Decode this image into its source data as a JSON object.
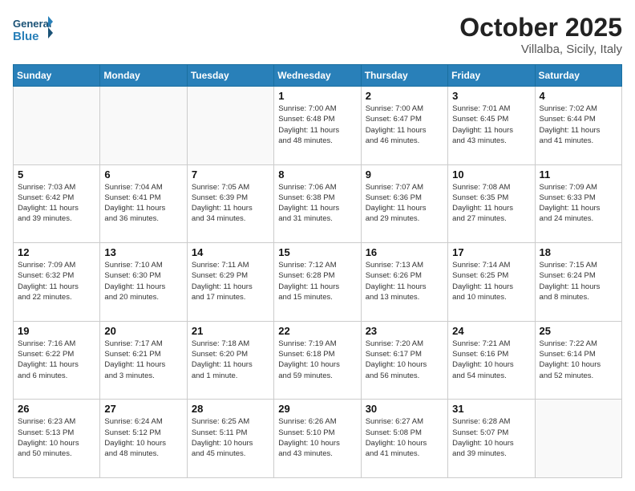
{
  "header": {
    "logo_general": "General",
    "logo_blue": "Blue",
    "month_title": "October 2025",
    "location": "Villalba, Sicily, Italy"
  },
  "days_of_week": [
    "Sunday",
    "Monday",
    "Tuesday",
    "Wednesday",
    "Thursday",
    "Friday",
    "Saturday"
  ],
  "weeks": [
    [
      {
        "day": "",
        "info": ""
      },
      {
        "day": "",
        "info": ""
      },
      {
        "day": "",
        "info": ""
      },
      {
        "day": "1",
        "info": "Sunrise: 7:00 AM\nSunset: 6:48 PM\nDaylight: 11 hours\nand 48 minutes."
      },
      {
        "day": "2",
        "info": "Sunrise: 7:00 AM\nSunset: 6:47 PM\nDaylight: 11 hours\nand 46 minutes."
      },
      {
        "day": "3",
        "info": "Sunrise: 7:01 AM\nSunset: 6:45 PM\nDaylight: 11 hours\nand 43 minutes."
      },
      {
        "day": "4",
        "info": "Sunrise: 7:02 AM\nSunset: 6:44 PM\nDaylight: 11 hours\nand 41 minutes."
      }
    ],
    [
      {
        "day": "5",
        "info": "Sunrise: 7:03 AM\nSunset: 6:42 PM\nDaylight: 11 hours\nand 39 minutes."
      },
      {
        "day": "6",
        "info": "Sunrise: 7:04 AM\nSunset: 6:41 PM\nDaylight: 11 hours\nand 36 minutes."
      },
      {
        "day": "7",
        "info": "Sunrise: 7:05 AM\nSunset: 6:39 PM\nDaylight: 11 hours\nand 34 minutes."
      },
      {
        "day": "8",
        "info": "Sunrise: 7:06 AM\nSunset: 6:38 PM\nDaylight: 11 hours\nand 31 minutes."
      },
      {
        "day": "9",
        "info": "Sunrise: 7:07 AM\nSunset: 6:36 PM\nDaylight: 11 hours\nand 29 minutes."
      },
      {
        "day": "10",
        "info": "Sunrise: 7:08 AM\nSunset: 6:35 PM\nDaylight: 11 hours\nand 27 minutes."
      },
      {
        "day": "11",
        "info": "Sunrise: 7:09 AM\nSunset: 6:33 PM\nDaylight: 11 hours\nand 24 minutes."
      }
    ],
    [
      {
        "day": "12",
        "info": "Sunrise: 7:09 AM\nSunset: 6:32 PM\nDaylight: 11 hours\nand 22 minutes."
      },
      {
        "day": "13",
        "info": "Sunrise: 7:10 AM\nSunset: 6:30 PM\nDaylight: 11 hours\nand 20 minutes."
      },
      {
        "day": "14",
        "info": "Sunrise: 7:11 AM\nSunset: 6:29 PM\nDaylight: 11 hours\nand 17 minutes."
      },
      {
        "day": "15",
        "info": "Sunrise: 7:12 AM\nSunset: 6:28 PM\nDaylight: 11 hours\nand 15 minutes."
      },
      {
        "day": "16",
        "info": "Sunrise: 7:13 AM\nSunset: 6:26 PM\nDaylight: 11 hours\nand 13 minutes."
      },
      {
        "day": "17",
        "info": "Sunrise: 7:14 AM\nSunset: 6:25 PM\nDaylight: 11 hours\nand 10 minutes."
      },
      {
        "day": "18",
        "info": "Sunrise: 7:15 AM\nSunset: 6:24 PM\nDaylight: 11 hours\nand 8 minutes."
      }
    ],
    [
      {
        "day": "19",
        "info": "Sunrise: 7:16 AM\nSunset: 6:22 PM\nDaylight: 11 hours\nand 6 minutes."
      },
      {
        "day": "20",
        "info": "Sunrise: 7:17 AM\nSunset: 6:21 PM\nDaylight: 11 hours\nand 3 minutes."
      },
      {
        "day": "21",
        "info": "Sunrise: 7:18 AM\nSunset: 6:20 PM\nDaylight: 11 hours\nand 1 minute."
      },
      {
        "day": "22",
        "info": "Sunrise: 7:19 AM\nSunset: 6:18 PM\nDaylight: 10 hours\nand 59 minutes."
      },
      {
        "day": "23",
        "info": "Sunrise: 7:20 AM\nSunset: 6:17 PM\nDaylight: 10 hours\nand 56 minutes."
      },
      {
        "day": "24",
        "info": "Sunrise: 7:21 AM\nSunset: 6:16 PM\nDaylight: 10 hours\nand 54 minutes."
      },
      {
        "day": "25",
        "info": "Sunrise: 7:22 AM\nSunset: 6:14 PM\nDaylight: 10 hours\nand 52 minutes."
      }
    ],
    [
      {
        "day": "26",
        "info": "Sunrise: 6:23 AM\nSunset: 5:13 PM\nDaylight: 10 hours\nand 50 minutes."
      },
      {
        "day": "27",
        "info": "Sunrise: 6:24 AM\nSunset: 5:12 PM\nDaylight: 10 hours\nand 48 minutes."
      },
      {
        "day": "28",
        "info": "Sunrise: 6:25 AM\nSunset: 5:11 PM\nDaylight: 10 hours\nand 45 minutes."
      },
      {
        "day": "29",
        "info": "Sunrise: 6:26 AM\nSunset: 5:10 PM\nDaylight: 10 hours\nand 43 minutes."
      },
      {
        "day": "30",
        "info": "Sunrise: 6:27 AM\nSunset: 5:08 PM\nDaylight: 10 hours\nand 41 minutes."
      },
      {
        "day": "31",
        "info": "Sunrise: 6:28 AM\nSunset: 5:07 PM\nDaylight: 10 hours\nand 39 minutes."
      },
      {
        "day": "",
        "info": ""
      }
    ]
  ]
}
